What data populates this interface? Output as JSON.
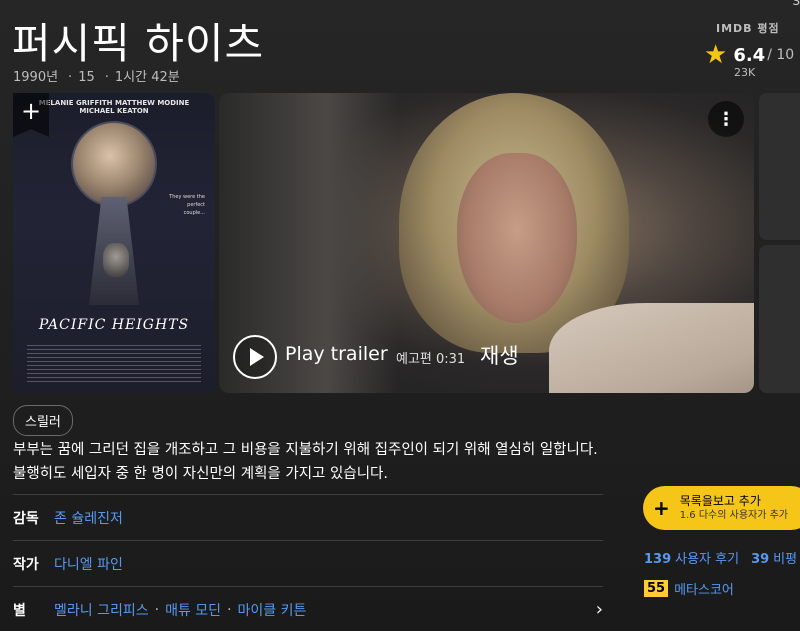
{
  "movie": {
    "title": "퍼시픽 하이츠",
    "year": "1990년",
    "certificate": "15",
    "runtime": "1시간 42분"
  },
  "corner_clip": "S",
  "rating": {
    "label": "IMDB 평점",
    "score": "6.4",
    "out_of": "/ 10",
    "votes": "23K"
  },
  "poster": {
    "names_line1": "MELANIE GRIFFITH    MATTHEW MODINE",
    "names_line2": "MICHAEL KEATON",
    "tagline": "They were the perfect couple...",
    "poster_title": "PACIFIC HEIGHTS"
  },
  "trailer": {
    "play_label": "Play trailer",
    "meta": "예고편 0:31",
    "action": "재생"
  },
  "genre": "스릴러",
  "plot": "부부는 꿈에 그리던 집을 개조하고 그 비용을 지불하기 위해 집주인이 되기 위해 열심히 일합니다. 불행히도 세입자 중 한 명이 자신만의 계획을 가지고 있습니다.",
  "credits": {
    "director_label": "감독",
    "director": "존 슐레진저",
    "writer_label": "작가",
    "writer": "다니엘 파인",
    "stars_label": "별",
    "stars": [
      "멜라니 그리피스",
      "매튜 모딘",
      "마이클 키튼"
    ]
  },
  "watchlist": {
    "main": "목록을보고 추가",
    "sub": "1.6 다수의 사용자가 추가"
  },
  "reviews": {
    "user_count": "139",
    "user_label": "사용자 후기",
    "critic_count": "39",
    "critic_label": "비평"
  },
  "metascore": {
    "value": "55",
    "label": "메타스코어"
  },
  "colors": {
    "accent_yellow": "#f5c518",
    "link_blue": "#5799ef",
    "metascore_yellow": "#ffcc33"
  }
}
